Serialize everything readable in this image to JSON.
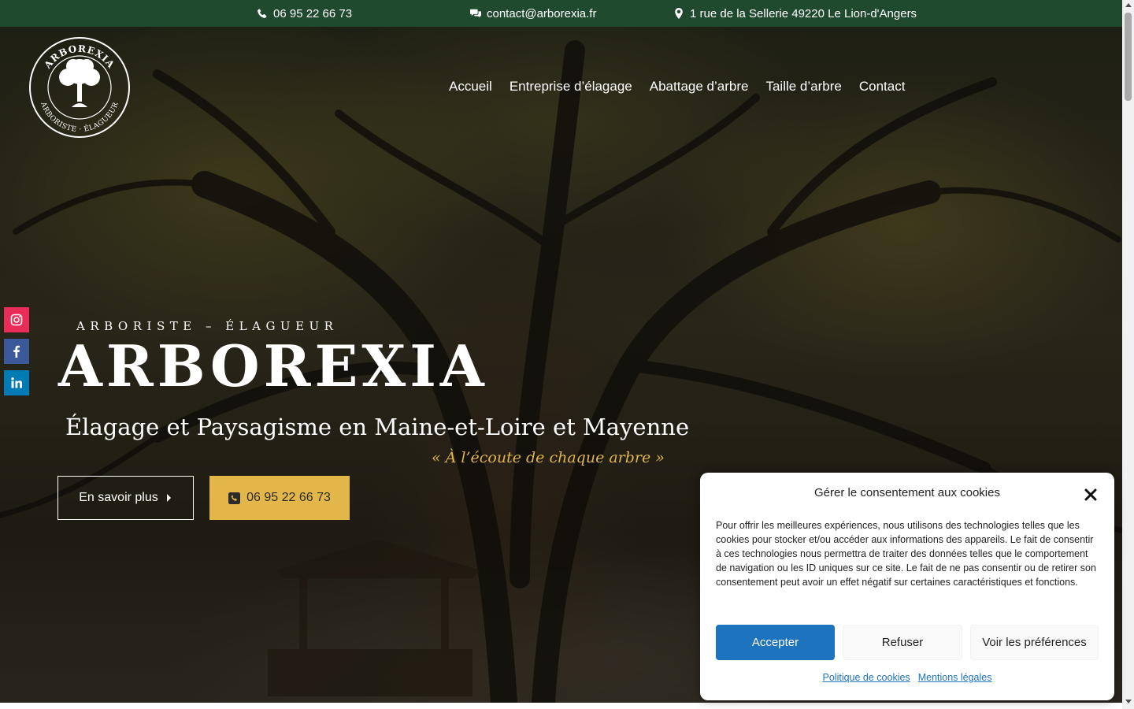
{
  "topbar": {
    "phone": "06 95 22 66 73",
    "email": "contact@arborexia.fr",
    "address": "1 rue de la Sellerie 49220 Le Lion-d'Angers",
    "background": "#1f4a2e"
  },
  "logo": {
    "top_text": "ARBOREXIA",
    "bottom_text": "ARBORISTE · ÉLAGUEUR"
  },
  "nav": {
    "items": [
      "Accueil",
      "Entreprise d’élagage",
      "Abattage d’arbre",
      "Taille d’arbre",
      "Contact"
    ]
  },
  "social": {
    "items": [
      {
        "name": "instagram",
        "icon": "instagram-icon",
        "color": "#ea2c59"
      },
      {
        "name": "facebook",
        "icon": "facebook-icon",
        "color": "#3b5998"
      },
      {
        "name": "linkedin",
        "icon": "linkedin-icon",
        "color": "#007bb6"
      }
    ]
  },
  "hero": {
    "kicker": "ARBORISTE – ÉLAGUEUR",
    "brand": "ARBOREXIA",
    "subtitle": "Élagage et Paysagisme en Maine-et-Loire et Mayenne",
    "quote": "« À l’écoute de chaque arbre »",
    "learn_more": "En savoir plus",
    "phone_button": "06 95 22 66 73",
    "accent": "#e3b64a"
  },
  "cookie": {
    "title": "Gérer le consentement aux cookies",
    "body": "Pour offrir les meilleures expériences, nous utilisons des technologies telles que les cookies pour stocker et/ou accéder aux informations des appareils. Le fait de consentir à ces technologies nous permettra de traiter des données telles que le comportement de navigation ou les ID uniques sur ce site. Le fait de ne pas consentir ou de retirer son consentement peut avoir un effet négatif sur certaines caractéristiques et fonctions.",
    "accept": "Accepter",
    "refuse": "Refuser",
    "preferences": "Voir les préférences",
    "policy_link": "Politique de cookies",
    "legal_link": "Mentions légales",
    "accent": "#1e73be"
  }
}
